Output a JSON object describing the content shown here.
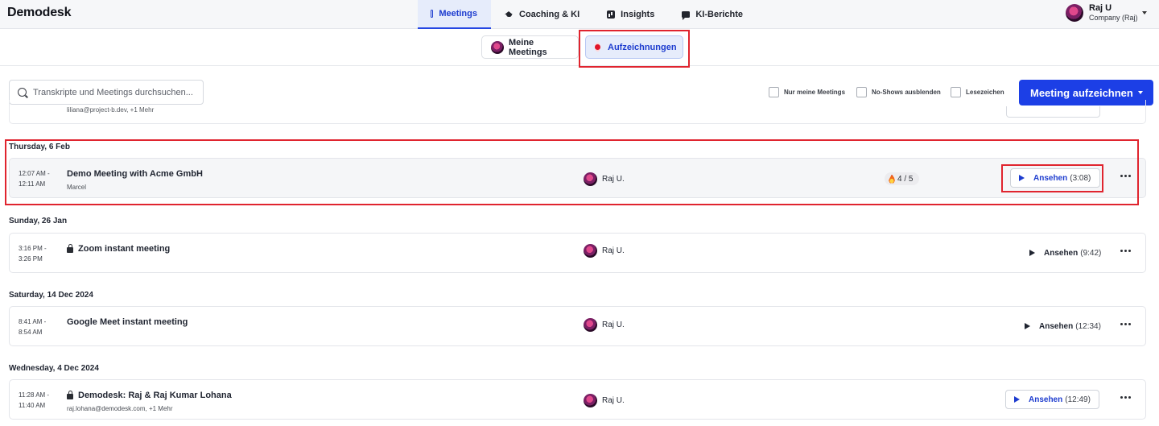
{
  "app": {
    "logo": "Demodesk"
  },
  "nav": {
    "items": [
      {
        "label": "Meetings",
        "icon": "calendar-icon",
        "active": true
      },
      {
        "label": "Coaching & KI",
        "icon": "graduation-cap-icon",
        "active": false
      },
      {
        "label": "Insights",
        "icon": "chart-icon",
        "active": false
      },
      {
        "label": "KI-Berichte",
        "icon": "chat-icon",
        "active": false
      }
    ]
  },
  "user": {
    "name": "Raj U",
    "company": "Company (Raj)"
  },
  "subtabs": {
    "mine": "Meine Meetings",
    "recordings": "Aufzeichnungen"
  },
  "search": {
    "placeholder": "Transkripte und Meetings durchsuchen..."
  },
  "filters": {
    "only_mine": "Nur meine Meetings",
    "hide_noshows": "No-Shows ausblenden",
    "bookmarks": "Lesezeichen"
  },
  "record_button": {
    "label": "Meeting aufzeichnen"
  },
  "partial_row": {
    "participants": "liliana@project-b.dev, +1 Mehr"
  },
  "groups": [
    {
      "date": "Thursday, 6 Feb",
      "meetings": [
        {
          "start": "12:07 AM -",
          "end": "12:11 AM",
          "title": "Demo Meeting with Acme GmbH",
          "participants": "Marcel",
          "host": "Raj U.",
          "score": "4 / 5",
          "watch": "Ansehen",
          "duration": "(3:08)",
          "locked": false
        }
      ]
    },
    {
      "date": "Sunday, 26 Jan",
      "meetings": [
        {
          "start": "3:16 PM -",
          "end": "3:26 PM",
          "title": "Zoom instant meeting",
          "participants": "",
          "host": "Raj U.",
          "watch": "Ansehen",
          "duration": "(9:42)",
          "locked": true
        }
      ]
    },
    {
      "date": "Saturday, 14 Dec 2024",
      "meetings": [
        {
          "start": "8:41 AM -",
          "end": "8:54 AM",
          "title": "Google Meet instant meeting",
          "participants": "",
          "host": "Raj U.",
          "watch": "Ansehen",
          "duration": "(12:34)",
          "locked": false
        }
      ]
    },
    {
      "date": "Wednesday, 4 Dec 2024",
      "meetings": [
        {
          "start": "11:28 AM -",
          "end": "11:40 AM",
          "title": "Demodesk: Raj & Raj Kumar Lohana",
          "participants": "raj.lohana@demodesk.com, +1 Mehr",
          "host": "Raj U.",
          "watch": "Ansehen",
          "duration": "(12:49)",
          "locked": true
        }
      ]
    }
  ],
  "colors": {
    "accent": "#1c3fe6",
    "annotation": "#e0242e",
    "record_dot": "#e0152a"
  }
}
